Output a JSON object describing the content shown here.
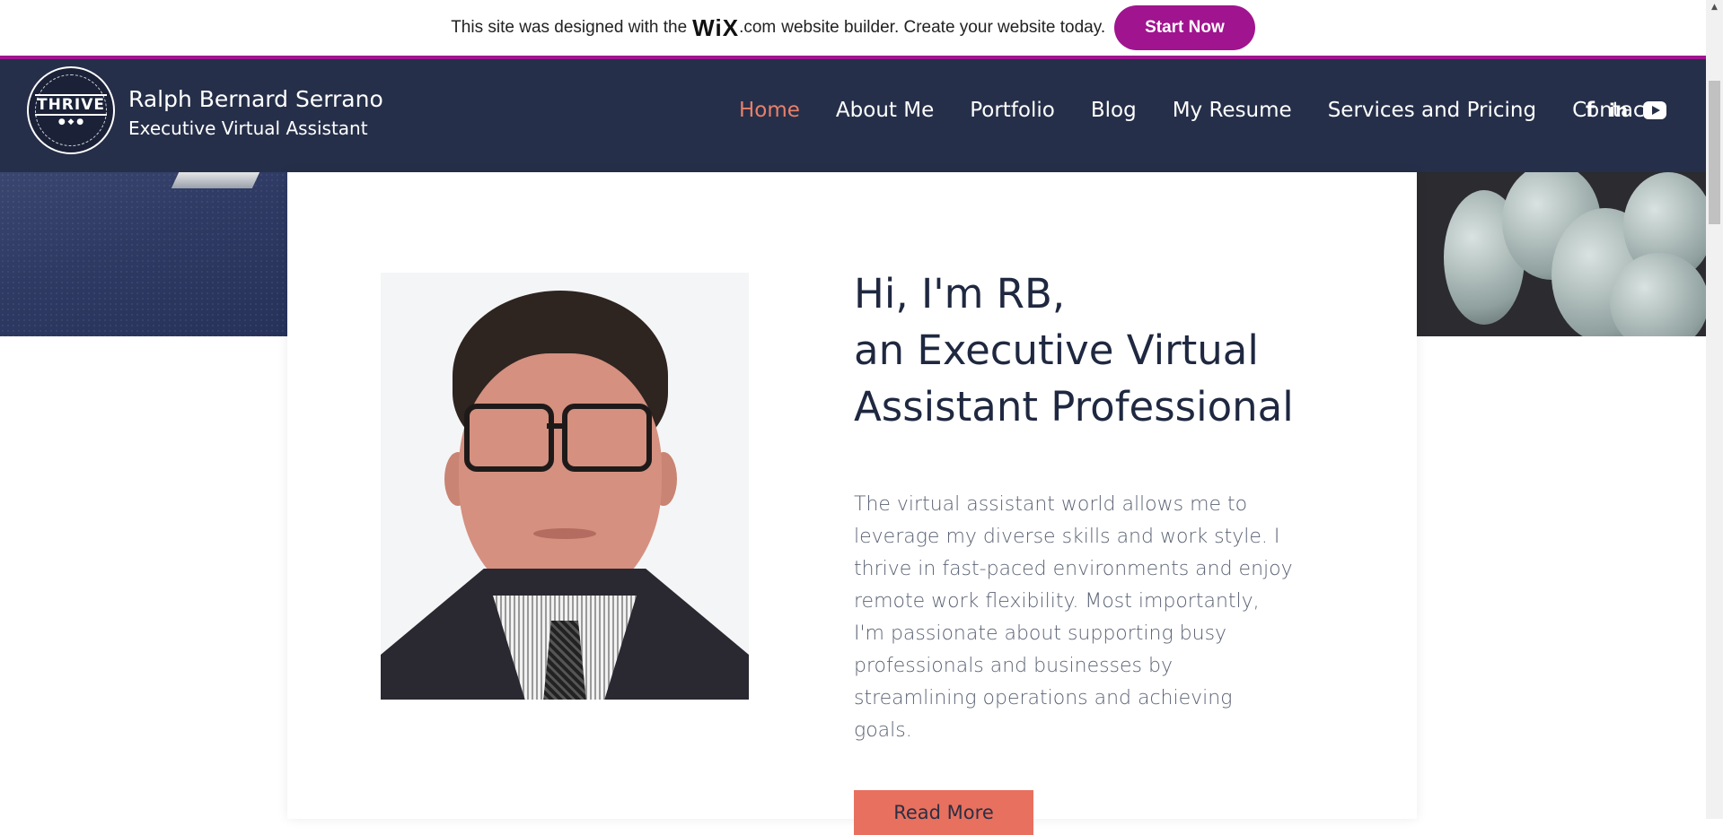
{
  "wix_banner": {
    "text_before": "This site was designed with the",
    "logo": "WiX",
    "dotcom": ".com",
    "text_after": "website builder. Create your website today.",
    "button_label": "Start Now",
    "accent_color": "#a0148f"
  },
  "header": {
    "logo_text": "THRIVE",
    "site_name": "Ralph Bernard Serrano",
    "tagline": "Executive Virtual Assistant",
    "background_color": "#262f49",
    "nav": [
      {
        "label": "Home",
        "active": true
      },
      {
        "label": "About Me",
        "active": false
      },
      {
        "label": "Portfolio",
        "active": false
      },
      {
        "label": "Blog",
        "active": false
      },
      {
        "label": "My Resume",
        "active": false
      },
      {
        "label": "Services and Pricing",
        "active": false
      },
      {
        "label": "Contact",
        "active": false
      }
    ],
    "active_color": "#e8806b",
    "social": [
      {
        "icon": "facebook-icon",
        "glyph": "f"
      },
      {
        "icon": "linkedin-icon",
        "glyph": "in"
      },
      {
        "icon": "youtube-icon",
        "glyph": ""
      }
    ]
  },
  "hero": {
    "headline_lines": [
      "Hi, I'm RB,",
      "an Executive Virtual",
      "Assistant Professional"
    ],
    "intro": "The virtual assistant world allows me to leverage my diverse skills and work style. I thrive in fast-paced environments and enjoy remote work flexibility. Most importantly, I'm passionate about supporting busy professionals and businesses by streamlining operations and achieving goals.",
    "button_label": "Read More",
    "button_color": "#e8705e"
  }
}
